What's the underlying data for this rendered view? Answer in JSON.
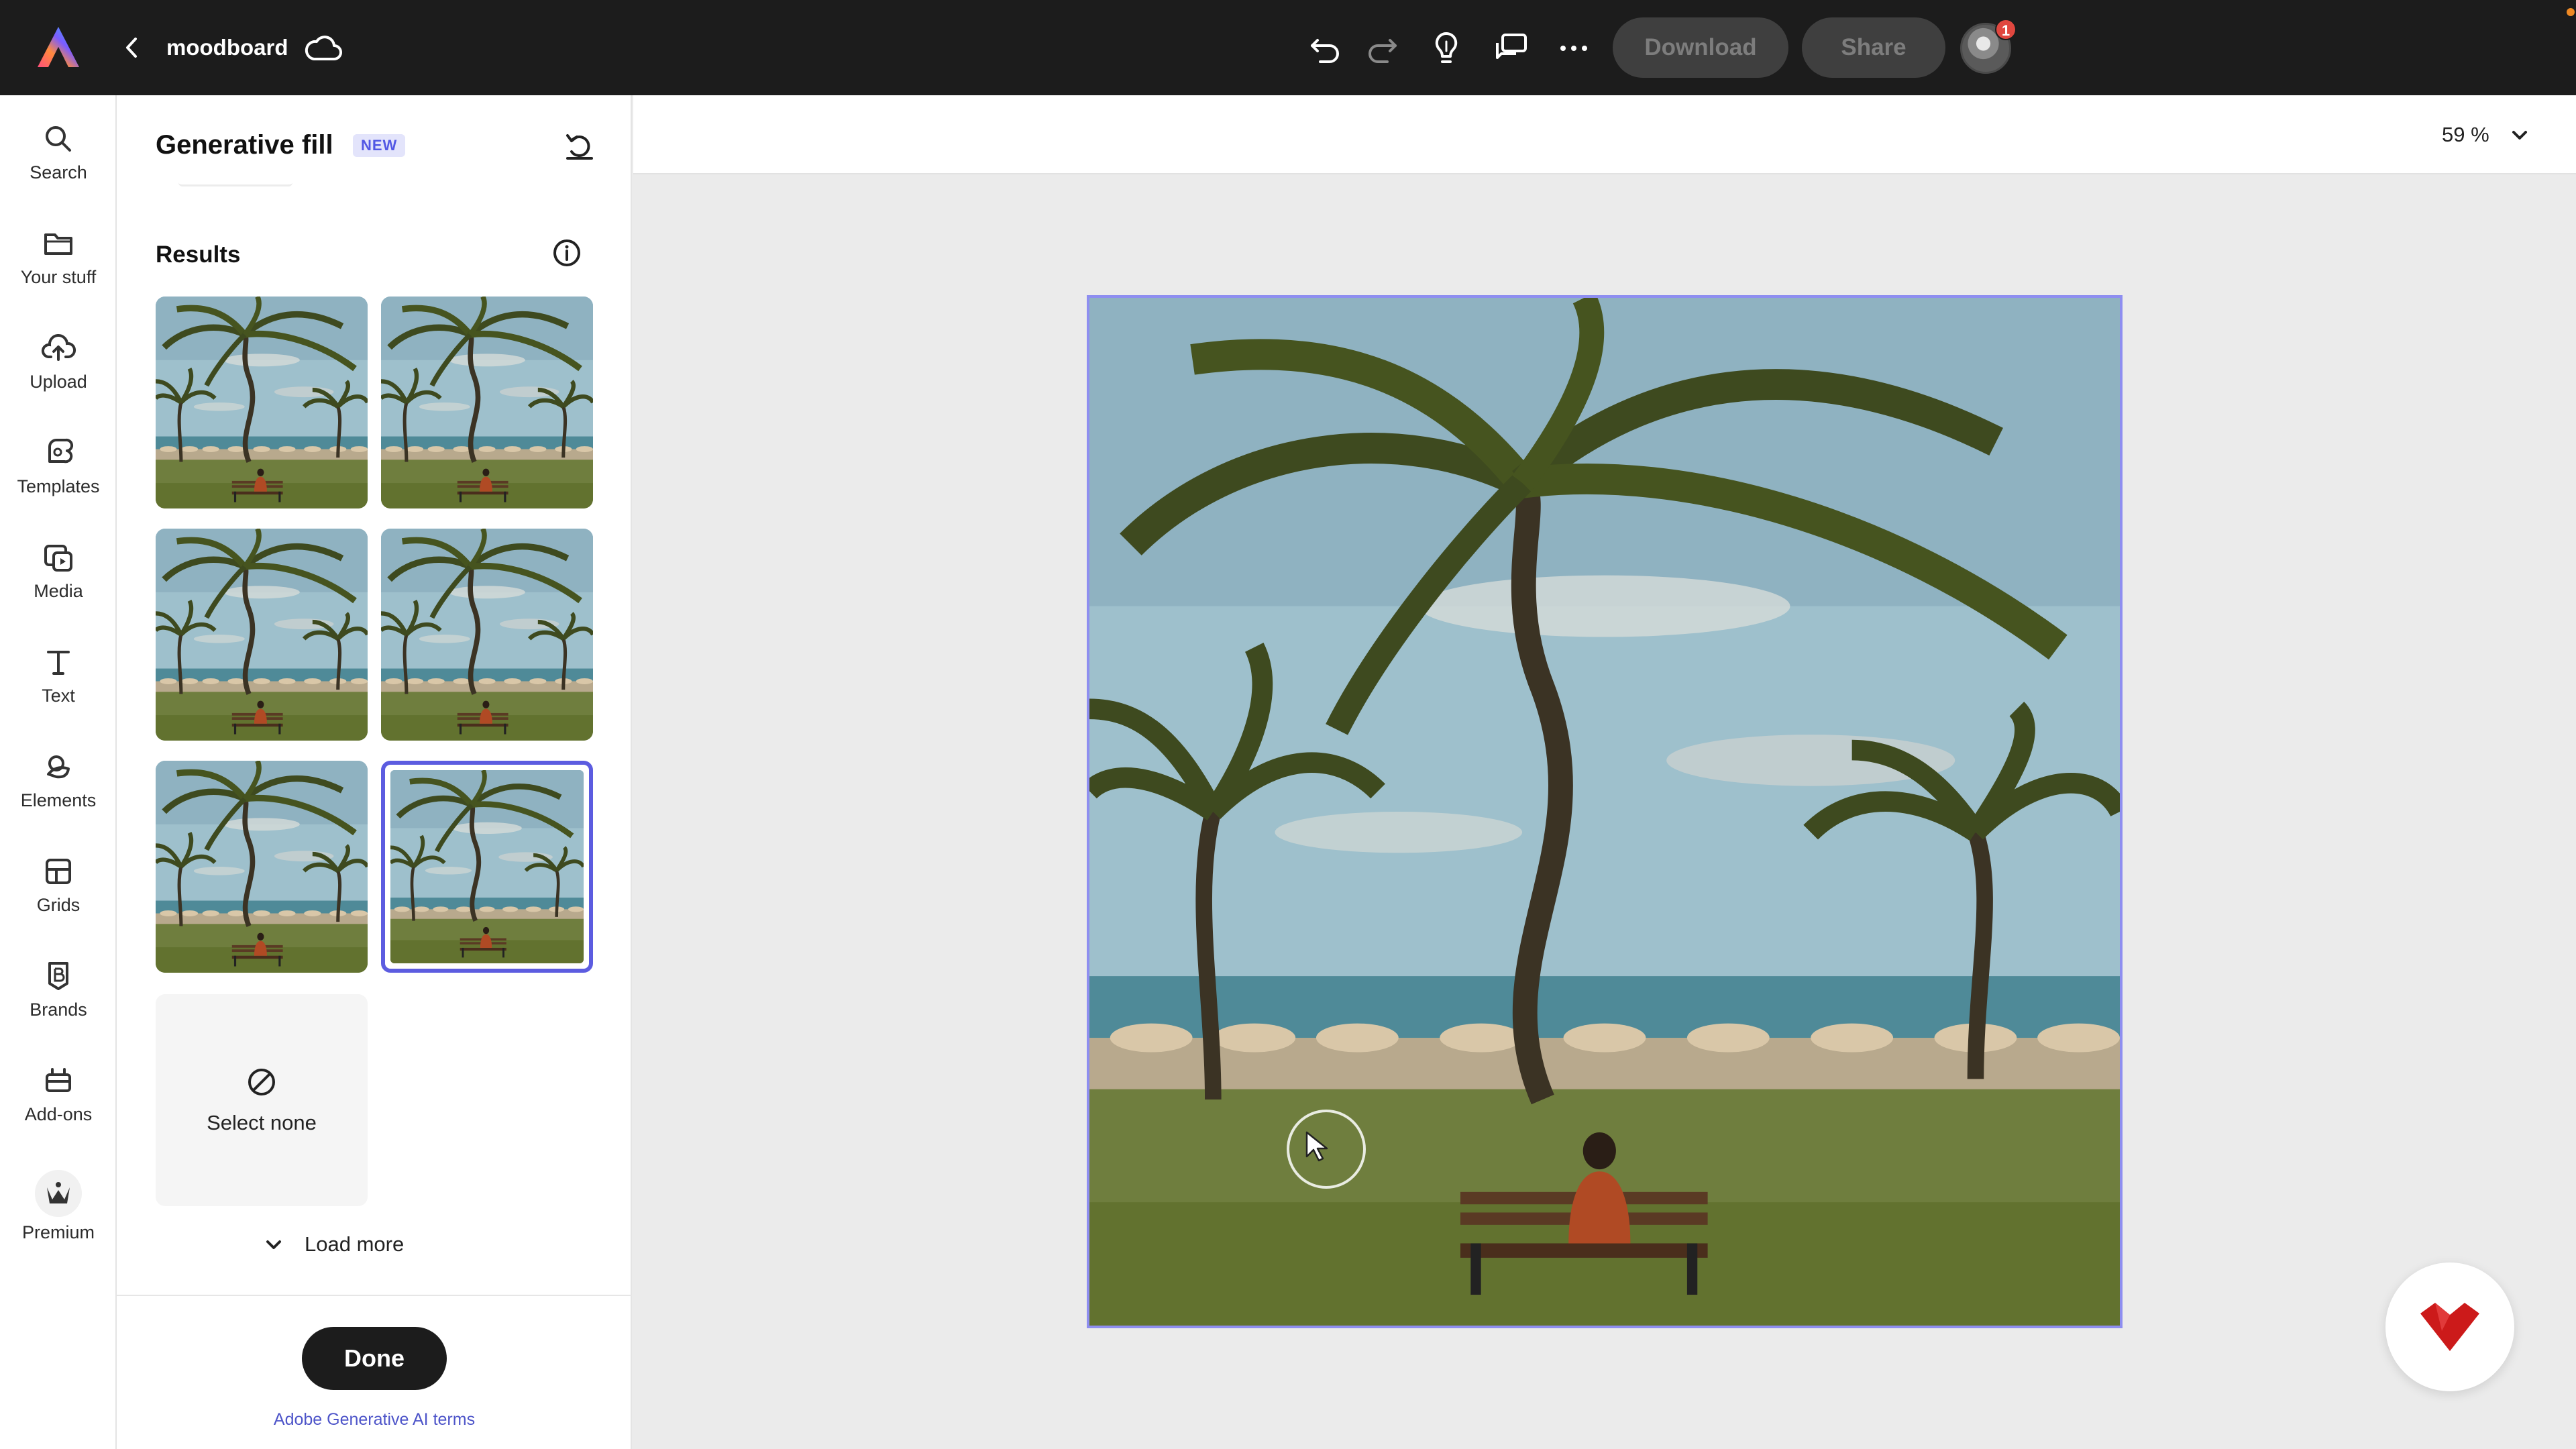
{
  "topbar": {
    "doc_title": "moodboard",
    "download_label": "Download",
    "share_label": "Share",
    "notification_count": "1",
    "icons": [
      "adobe-express-logo",
      "back-chevron-icon",
      "cloud-icon",
      "undo-icon",
      "redo-icon",
      "lightbulb-icon",
      "comments-icon",
      "more-icon"
    ]
  },
  "rail": {
    "items": [
      {
        "label": "Search",
        "icon": "search-icon"
      },
      {
        "label": "Your stuff",
        "icon": "folder-icon"
      },
      {
        "label": "Upload",
        "icon": "upload-icon"
      },
      {
        "label": "Templates",
        "icon": "templates-icon"
      },
      {
        "label": "Media",
        "icon": "media-icon"
      },
      {
        "label": "Text",
        "icon": "text-icon"
      },
      {
        "label": "Elements",
        "icon": "elements-icon"
      },
      {
        "label": "Grids",
        "icon": "grids-icon"
      },
      {
        "label": "Brands",
        "icon": "brands-icon"
      },
      {
        "label": "Add-ons",
        "icon": "add-ons-icon"
      },
      {
        "label": "Premium",
        "icon": "premium-crown-icon"
      }
    ]
  },
  "panel": {
    "title": "Generative fill",
    "badge": "NEW",
    "results_label": "Results",
    "select_none_label": "Select none",
    "load_more_label": "Load more",
    "done_label": "Done",
    "terms_label": "Adobe Generative AI terms",
    "results": [
      {
        "selected": false
      },
      {
        "selected": false
      },
      {
        "selected": false
      },
      {
        "selected": false
      },
      {
        "selected": false
      },
      {
        "selected": true
      }
    ]
  },
  "canvas": {
    "zoom_label": "59 %"
  },
  "colors": {
    "topbar_bg": "#1c1c1c",
    "accent": "#5c5ce0",
    "badge_bg": "#e3e4fb",
    "badge_text": "#5258e4",
    "link": "#4e55c9",
    "fab_mark": "#cc1a1a"
  }
}
